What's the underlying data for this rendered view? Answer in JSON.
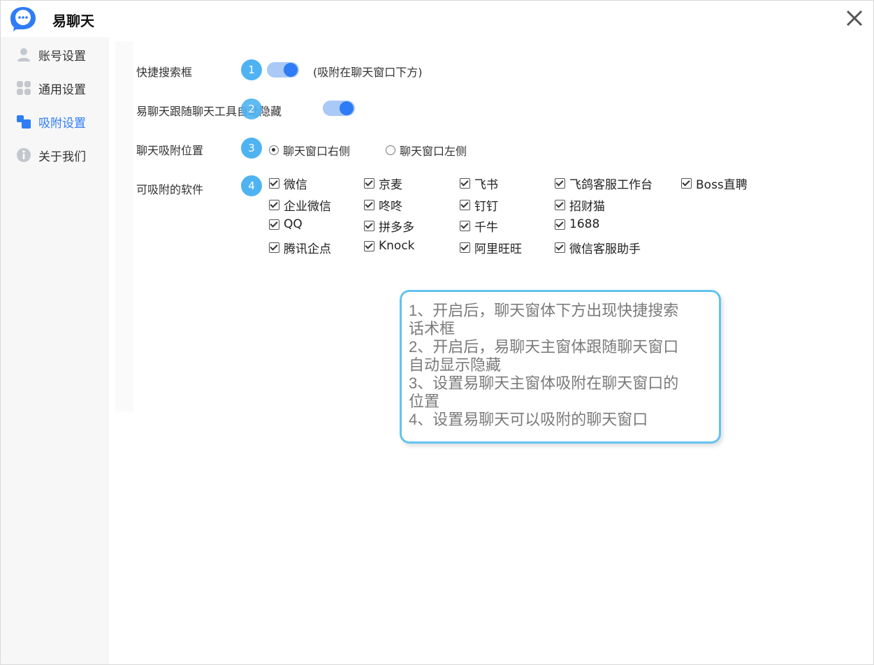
{
  "app": {
    "title": "易聊天",
    "close_icon": "close-icon"
  },
  "sidebar": {
    "items": [
      {
        "label": "账号设置",
        "icon": "user-icon",
        "active": false
      },
      {
        "label": "通用设置",
        "icon": "grid-icon",
        "active": false
      },
      {
        "label": "吸附设置",
        "icon": "attach-icon",
        "active": true
      },
      {
        "label": "关于我们",
        "icon": "info-icon",
        "active": false
      }
    ]
  },
  "settings": {
    "quick_search": {
      "label": "快捷搜索框",
      "badge": "1",
      "enabled": true,
      "hint": "(吸附在聊天窗口下方)"
    },
    "auto_hide": {
      "label": "易聊天跟随聊天工具自动隐藏",
      "badge": "2",
      "enabled": true
    },
    "position": {
      "label": "聊天吸附位置",
      "badge": "3",
      "options": [
        "聊天窗口右侧",
        "聊天窗口左侧"
      ],
      "selected": "聊天窗口右侧"
    },
    "software": {
      "label": "可吸附的软件",
      "badge": "4",
      "items": [
        "微信",
        "京麦",
        "飞书",
        "飞鸽客服工作台",
        "Boss直聘",
        "企业微信",
        "咚咚",
        "钉钉",
        "招财猫",
        "QQ",
        "拼多多",
        "千牛",
        "1688",
        "腾讯企点",
        "Knock",
        "阿里旺旺",
        "微信客服助手"
      ]
    }
  },
  "note": {
    "lines": [
      "1、开启后，聊天窗体下方出现快捷搜索",
      "话术框",
      "2、开启后，易聊天主窗体跟随聊天窗口",
      "自动显示隐藏",
      "3、设置易聊天主窗体吸附在聊天窗口的",
      "位置",
      "4、设置易聊天可以吸附的聊天窗口"
    ]
  },
  "colors": {
    "accent": "#2e7cf6",
    "badge": "#4fb3f2",
    "note_border": "#62c3f0"
  }
}
